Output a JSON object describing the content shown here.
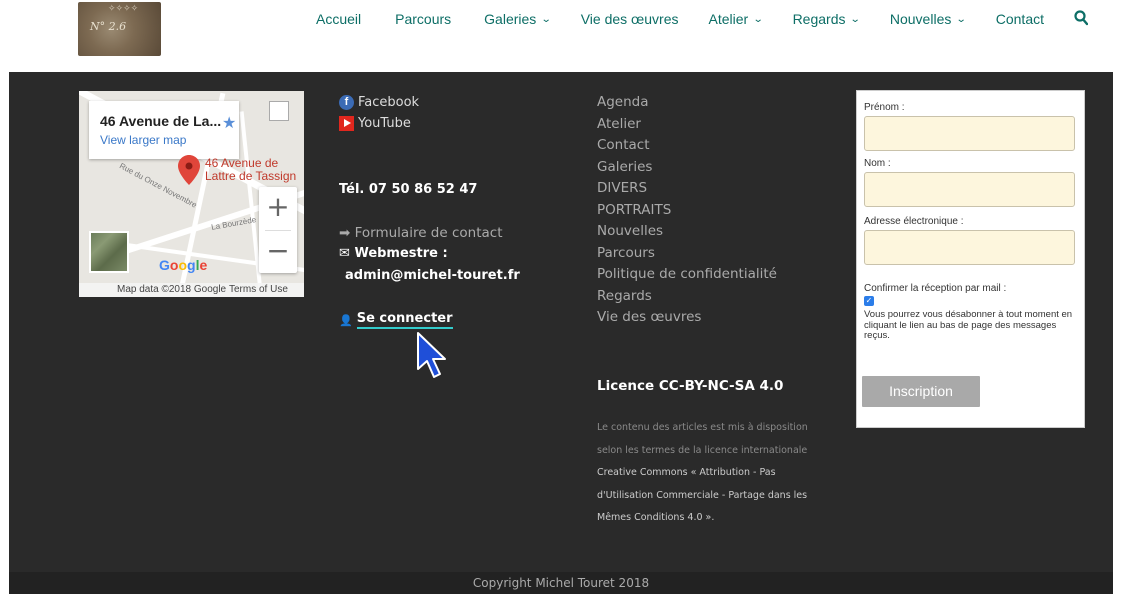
{
  "header": {
    "nav": [
      {
        "label": "Accueil",
        "dropdown": false
      },
      {
        "label": "Parcours",
        "dropdown": false
      },
      {
        "label": "Galeries",
        "dropdown": true
      },
      {
        "label": "Vie des œuvres",
        "dropdown": false
      },
      {
        "label": "Atelier",
        "dropdown": true
      },
      {
        "label": "Regards",
        "dropdown": true
      },
      {
        "label": "Nouvelles",
        "dropdown": true
      },
      {
        "label": "Contact",
        "dropdown": false
      }
    ],
    "accent_color": "#0d6e66",
    "search_icon": "search-icon",
    "logo_text": "N° 2.6"
  },
  "map": {
    "card_title": "46 Avenue de La...",
    "view_larger": "View larger map",
    "pin_label_line1": "46 Avenue de",
    "pin_label_line2": "Lattre de Tassign",
    "street_1": "Rue du Onze Novembre",
    "street_2": "La Bourzède",
    "zoom_in": "+",
    "zoom_out": "−",
    "google": [
      "G",
      "o",
      "o",
      "g",
      "l",
      "e"
    ],
    "data_text": "Map data ©2018 Google",
    "terms_text": "Terms of Use"
  },
  "social": {
    "facebook": "Facebook",
    "youtube": "YouTube"
  },
  "contact": {
    "tel": "Tél. 07 50 86 52 47",
    "form_link": "Formulaire de contact",
    "webmestre": "Webmestre :",
    "email": "admin@michel-touret.fr",
    "login": "Se connecter"
  },
  "menu": [
    "Agenda",
    "Atelier",
    "Contact",
    "Galeries",
    "DIVERS",
    "PORTRAITS",
    "Nouvelles",
    "Parcours",
    "Politique de confidentialité",
    "Regards",
    "Vie des œuvres"
  ],
  "licence": {
    "title": "Licence CC-BY-NC-SA 4.0",
    "line1": "Le contenu des articles est mis à disposition",
    "line2": "selon les termes de la licence internationale",
    "line3": "Creative Commons « Attribution - Pas",
    "line4": "d'Utilisation Commerciale - Partage dans les",
    "line5": "Mêmes Conditions 4.0 »."
  },
  "newsletter": {
    "firstname_label": "Prénom :",
    "firstname_value": "",
    "lastname_label": "Nom :",
    "lastname_value": "",
    "email_label": "Adresse électronique :",
    "email_value": "",
    "confirm_label": "Confirmer la réception par mail :",
    "confirm_checked": true,
    "note": "Vous pourrez vous désabonner à tout moment en cliquant le lien au bas de page des messages reçus.",
    "submit": "Inscription"
  },
  "footer": {
    "copyright": "Copyright Michel Touret 2018"
  }
}
